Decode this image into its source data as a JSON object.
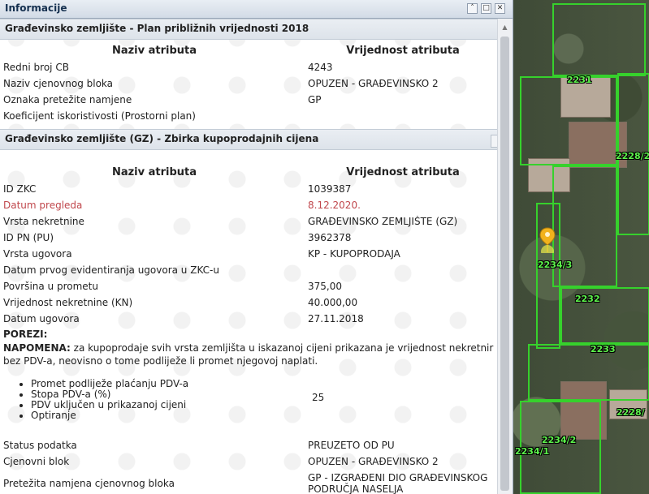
{
  "panel": {
    "title": "Informacije"
  },
  "section1": {
    "title": "Građevinsko zemljište - Plan približnih vrijednosti 2018",
    "header_name": "Naziv atributa",
    "header_value": "Vrijednost atributa",
    "rows": [
      {
        "name": "Redni broj CB",
        "value": "4243"
      },
      {
        "name": "Naziv cjenovnog bloka",
        "value": "OPUZEN - GRAĐEVINSKO 2"
      },
      {
        "name": "Oznaka pretežite namjene",
        "value": "GP"
      },
      {
        "name": "Koeficijent iskoristivosti (Prostorni plan)",
        "value": ""
      }
    ]
  },
  "section2": {
    "title": "Građevinsko zemljište (GZ) - Zbirka kupoprodajnih cijena",
    "header_name": "Naziv atributa",
    "header_value": "Vrijednost atributa",
    "rows": [
      {
        "name": "ID ZKC",
        "value": "1039387"
      },
      {
        "name": "Datum pregleda",
        "value": "8.12.2020."
      },
      {
        "name": "Vrsta nekretnine",
        "value": "GRAĐEVINSKO ZEMLJIŠTE (GZ)"
      },
      {
        "name": "ID PN (PU)",
        "value": "3962378"
      },
      {
        "name": "Vrsta ugovora",
        "value": "KP - KUPOPRODAJA"
      },
      {
        "name": "Datum prvog evidentiranja ugovora u ZKC-u",
        "value": ""
      },
      {
        "name": "Površina u prometu",
        "value": "375,00"
      },
      {
        "name": "Vrijednost nekretnine (KN)",
        "value": "40.000,00"
      },
      {
        "name": "Datum ugovora",
        "value": "27.11.2018"
      }
    ],
    "porezi_label": "POREZI:",
    "napomena_label": "NAPOMENA:",
    "napomena_line1": " za kupoprodaje svih vrsta zemljišta u iskazanoj cijeni prikazana je vrijednost nekretnir",
    "napomena_line2": "bez PDV-a, neovisno o tome podliježe li promet njegovoj naplati.",
    "bullets": [
      "Promet podliježe plaćanju PDV-a",
      "Stopa PDV-a (%)",
      "PDV uključen u prikazanoj cijeni",
      "Optiranje"
    ],
    "stopa_value": "25",
    "rows_after": [
      {
        "name": "Status podatka",
        "value": "PREUZETO OD PU"
      },
      {
        "name": "Cjenovni blok",
        "value": "OPUZEN - GRAĐEVINSKO 2"
      },
      {
        "name": "Pretežita namjena cjenovnog bloka",
        "value": "GP - IZGRAĐENI DIO GRAĐEVINSKOG PODRUČJA NASELJA"
      }
    ]
  },
  "map": {
    "parcel_labels": [
      "2231",
      "2228/2",
      "2234/3",
      "2232",
      "2233",
      "2228/",
      "2234/2",
      "2234/1"
    ],
    "parcel_color": "#36d12c",
    "marker_color": "#f2b21c"
  }
}
